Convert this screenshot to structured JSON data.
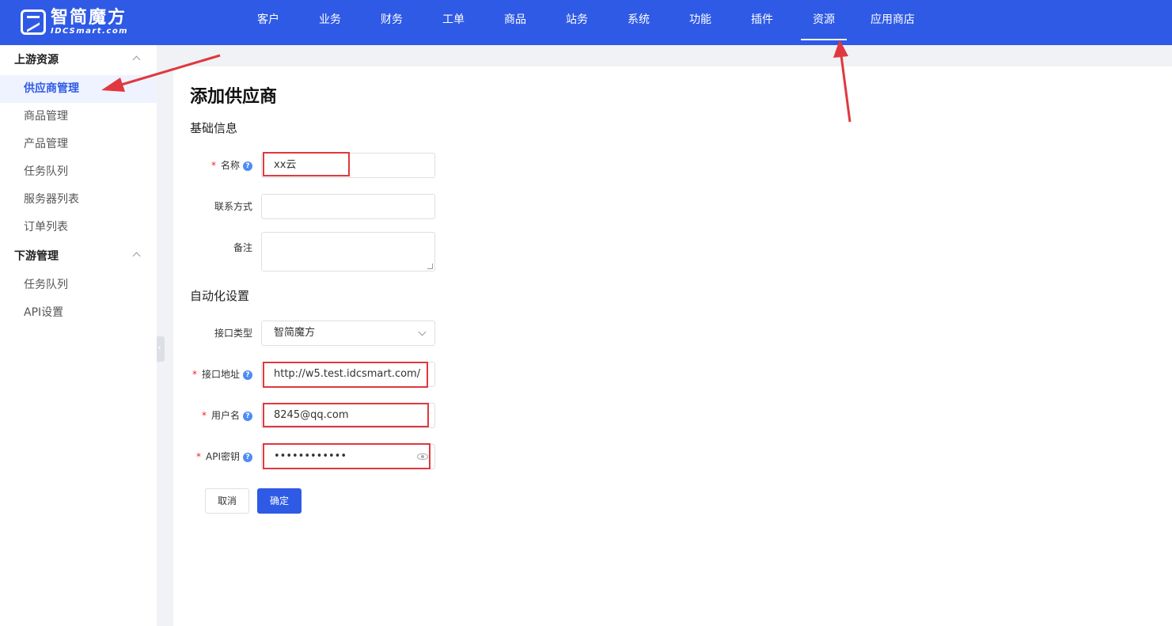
{
  "brand": {
    "name_cn": "智简魔方",
    "name_en": "IDCSmart.com"
  },
  "nav": {
    "items": [
      "客户",
      "业务",
      "财务",
      "工单",
      "商品",
      "站务",
      "系统",
      "功能",
      "插件",
      "资源",
      "应用商店"
    ],
    "active": "资源"
  },
  "sidebar": {
    "upstream": {
      "title": "上游资源",
      "items": [
        "供应商管理",
        "商品管理",
        "产品管理",
        "任务队列",
        "服务器列表",
        "订单列表"
      ]
    },
    "downstream": {
      "title": "下游管理",
      "items": [
        "任务队列",
        "API设置"
      ]
    },
    "active_item": "供应商管理"
  },
  "page": {
    "title": "添加供应商",
    "section_basic": "基础信息",
    "section_auto": "自动化设置"
  },
  "form": {
    "name": {
      "label": "名称",
      "required": true,
      "value": "xx云"
    },
    "contact": {
      "label": "联系方式",
      "value": ""
    },
    "remark": {
      "label": "备注",
      "value": ""
    },
    "interface_type": {
      "label": "接口类型",
      "value": "智简魔方"
    },
    "interface_url": {
      "label": "接口地址",
      "required": true,
      "value": "http://w5.test.idcsmart.com/"
    },
    "username": {
      "label": "用户名",
      "required": true,
      "value": "8245@qq.com"
    },
    "api_key": {
      "label": "API密钥",
      "required": true,
      "value": "••••••••••••"
    }
  },
  "buttons": {
    "cancel": "取消",
    "confirm": "确定"
  },
  "colors": {
    "primary": "#2f5ae6",
    "annotation": "#e0383e",
    "required": "#f5222d"
  }
}
